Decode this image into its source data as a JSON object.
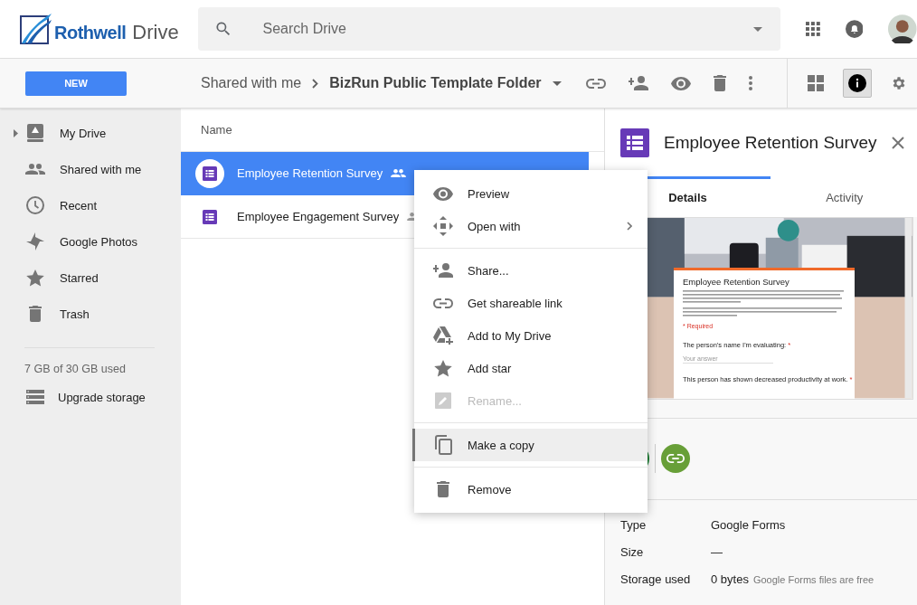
{
  "app": {
    "brand": "Rothwell",
    "product": "Drive"
  },
  "search": {
    "placeholder": "Search Drive"
  },
  "new_button": "NEW",
  "breadcrumb": [
    {
      "label": "Shared with me"
    },
    {
      "label": "BizRun Public Template Folder"
    }
  ],
  "info_toggle": {
    "on": true
  },
  "sidebar": {
    "items": [
      {
        "kind": "drive",
        "label": "My Drive",
        "expandable": true
      },
      {
        "kind": "shared",
        "label": "Shared with me",
        "expandable": false
      },
      {
        "kind": "recent",
        "label": "Recent",
        "expandable": false
      },
      {
        "kind": "photos",
        "label": "Google Photos",
        "expandable": false
      },
      {
        "kind": "starred",
        "label": "Starred",
        "expandable": false
      },
      {
        "kind": "trash",
        "label": "Trash",
        "expandable": false
      }
    ],
    "storage": "7 GB of 30 GB used",
    "upgrade": "Upgrade storage"
  },
  "files": {
    "column": "Name",
    "rows": [
      {
        "name": "Employee Retention Survey",
        "shared": true,
        "selected": true
      },
      {
        "name": "Employee Engagement Survey",
        "shared": true,
        "selected": false
      }
    ]
  },
  "context_menu": {
    "groups": [
      [
        {
          "kind": "preview",
          "label": "Preview",
          "submenu": false,
          "disabled": false,
          "highlighted": false
        },
        {
          "kind": "openwith",
          "label": "Open with",
          "submenu": true,
          "disabled": false,
          "highlighted": false
        }
      ],
      [
        {
          "kind": "share",
          "label": "Share...",
          "submenu": false,
          "disabled": false,
          "highlighted": false
        },
        {
          "kind": "link",
          "label": "Get shareable link",
          "submenu": false,
          "disabled": false,
          "highlighted": false
        },
        {
          "kind": "adddrive",
          "label": "Add to My Drive",
          "submenu": false,
          "disabled": false,
          "highlighted": false
        },
        {
          "kind": "star",
          "label": "Add star",
          "submenu": false,
          "disabled": false,
          "highlighted": false
        },
        {
          "kind": "rename",
          "label": "Rename...",
          "submenu": false,
          "disabled": true,
          "highlighted": false
        }
      ],
      [
        {
          "kind": "copy",
          "label": "Make a copy",
          "submenu": false,
          "disabled": false,
          "highlighted": true
        }
      ],
      [
        {
          "kind": "remove",
          "label": "Remove",
          "submenu": false,
          "disabled": false,
          "highlighted": false
        }
      ]
    ]
  },
  "details": {
    "title": "Employee Retention Survey",
    "tabs": [
      {
        "label": "Details",
        "selected": true
      },
      {
        "label": "Activity",
        "selected": false
      }
    ],
    "preview": {
      "title": "Employee Retention Survey",
      "required": "* Required",
      "questions": [
        {
          "text": "The person's name I'm evaluating:",
          "mark": "*",
          "placeholder": "Your answer"
        },
        {
          "text": "This person has shown decreased productivity at work.",
          "mark": "*"
        }
      ]
    },
    "properties": [
      {
        "label": "Type",
        "value": "Google Forms"
      },
      {
        "label": "Size",
        "value": "—"
      },
      {
        "label": "Storage used",
        "value": "0 bytes",
        "note": "Google Forms files are free"
      }
    ]
  }
}
